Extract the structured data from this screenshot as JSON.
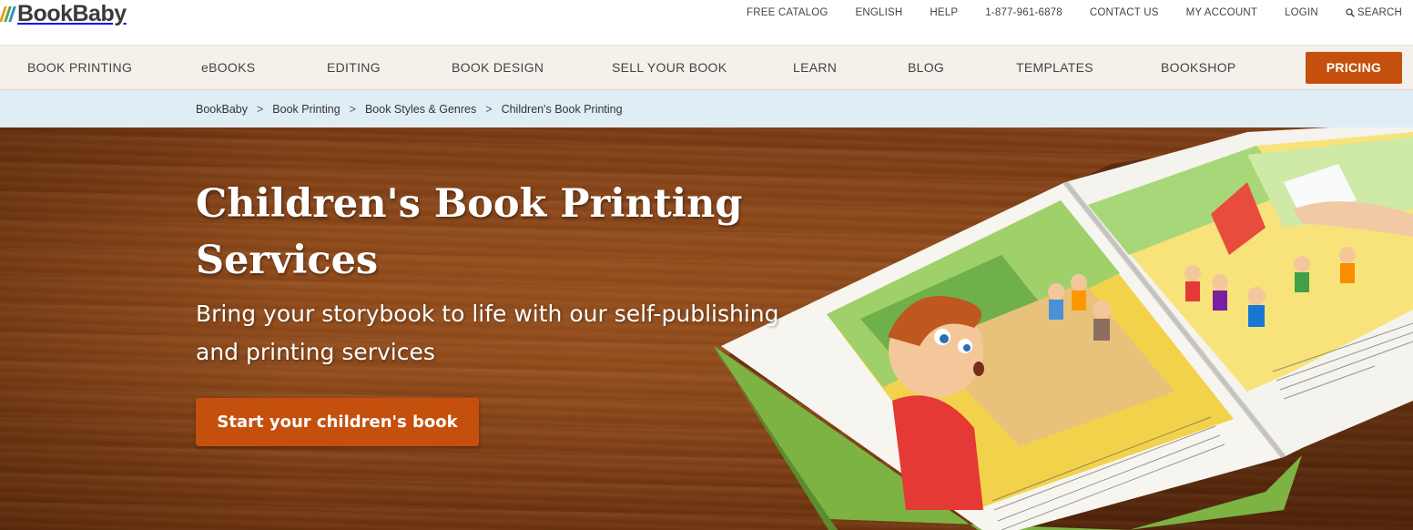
{
  "brand": {
    "name": "BookBaby",
    "stripe_colors": [
      "#e0a21c",
      "#5aa642",
      "#2f8fcf",
      "#c5500e"
    ]
  },
  "util_nav": {
    "items": [
      {
        "label": "FREE CATALOG"
      },
      {
        "label": "ENGLISH"
      },
      {
        "label": "HELP"
      },
      {
        "label": "1-877-961-6878"
      },
      {
        "label": "CONTACT US"
      },
      {
        "label": "MY ACCOUNT"
      },
      {
        "label": "LOGIN"
      }
    ],
    "search_label": "SEARCH",
    "search_icon": "search-icon"
  },
  "main_nav": {
    "items": [
      {
        "label": "BOOK PRINTING"
      },
      {
        "label": "eBOOKS"
      },
      {
        "label": "EDITING"
      },
      {
        "label": "BOOK DESIGN"
      },
      {
        "label": "SELL YOUR BOOK"
      },
      {
        "label": "LEARN"
      },
      {
        "label": "BLOG"
      },
      {
        "label": "TEMPLATES"
      },
      {
        "label": "BOOKSHOP"
      }
    ],
    "cta_label": "PRICING"
  },
  "breadcrumb": {
    "items": [
      "BookBaby",
      "Book Printing",
      "Book Styles & Genres",
      "Children's Book Printing"
    ],
    "separator": ">"
  },
  "hero": {
    "title": "Children's Book Printing Services",
    "subtitle": "Bring your storybook to life with our self-publishing and printing services",
    "cta_label": "Start your children's book"
  },
  "colors": {
    "accent": "#c5500e",
    "nav_bg": "#f4f0ea",
    "breadcrumb_bg": "#e1edf5",
    "wood": "#8b4719"
  }
}
